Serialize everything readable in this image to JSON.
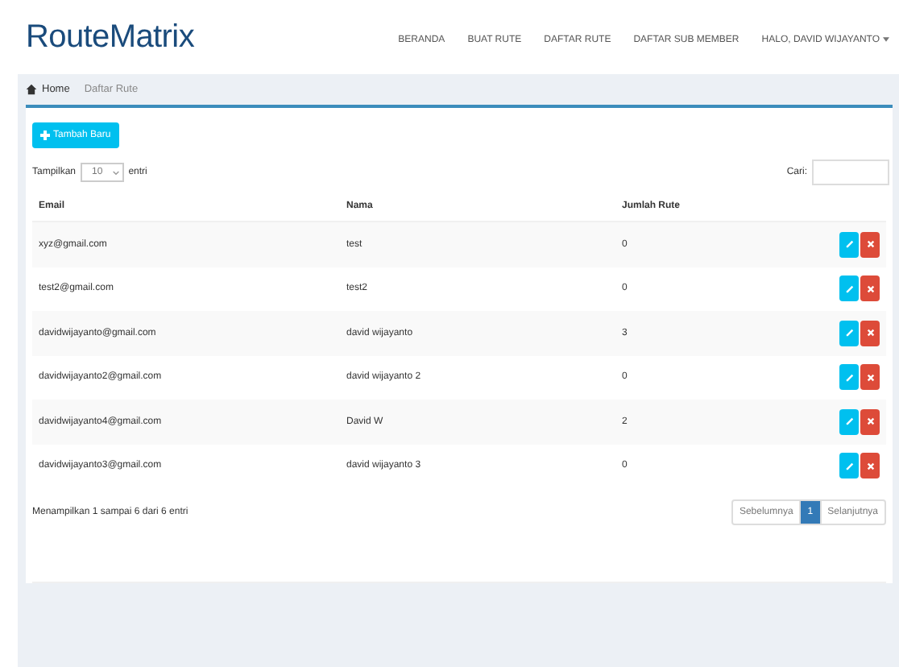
{
  "brand": "RouteMatrix",
  "nav": [
    {
      "label": "BERANDA",
      "kind": "link"
    },
    {
      "label": "BUAT RUTE",
      "kind": "link"
    },
    {
      "label": "DAFTAR RUTE",
      "kind": "link"
    },
    {
      "label": "DAFTAR SUB MEMBER",
      "kind": "link"
    },
    {
      "label": "HALO, DAVID WIJAYANTO",
      "kind": "dropdown"
    }
  ],
  "breadcrumb": [
    "Home",
    "Daftar Rute"
  ],
  "add_button": "Tambah Baru",
  "length": {
    "before": "Tampilkan",
    "value": "10",
    "after": "entri"
  },
  "search": {
    "label": "Cari:"
  },
  "table": {
    "columns": [
      "Email",
      "Nama",
      "Jumlah Rute"
    ],
    "rows": [
      {
        "email": "xyz@gmail.com",
        "name": "test",
        "count": "0"
      },
      {
        "email": "test2@gmail.com",
        "name": "test2",
        "count": "0"
      },
      {
        "email": "davidwijayanto@gmail.com",
        "name": "david wijayanto",
        "count": "3"
      },
      {
        "email": "davidwijayanto2@gmail.com",
        "name": "david wijayanto 2",
        "count": "0"
      },
      {
        "email": "davidwijayanto4@gmail.com",
        "name": "David W",
        "count": "2"
      },
      {
        "email": "davidwijayanto3@gmail.com",
        "name": "david wijayanto 3",
        "count": "0"
      }
    ]
  },
  "info": "Menampilkan 1 sampai 6 dari 6 entri",
  "pagination": [
    {
      "label": "Sebelumnya",
      "selected": false
    },
    {
      "label": "1",
      "selected": true
    },
    {
      "label": "Selanjutnya",
      "selected": false
    }
  ]
}
